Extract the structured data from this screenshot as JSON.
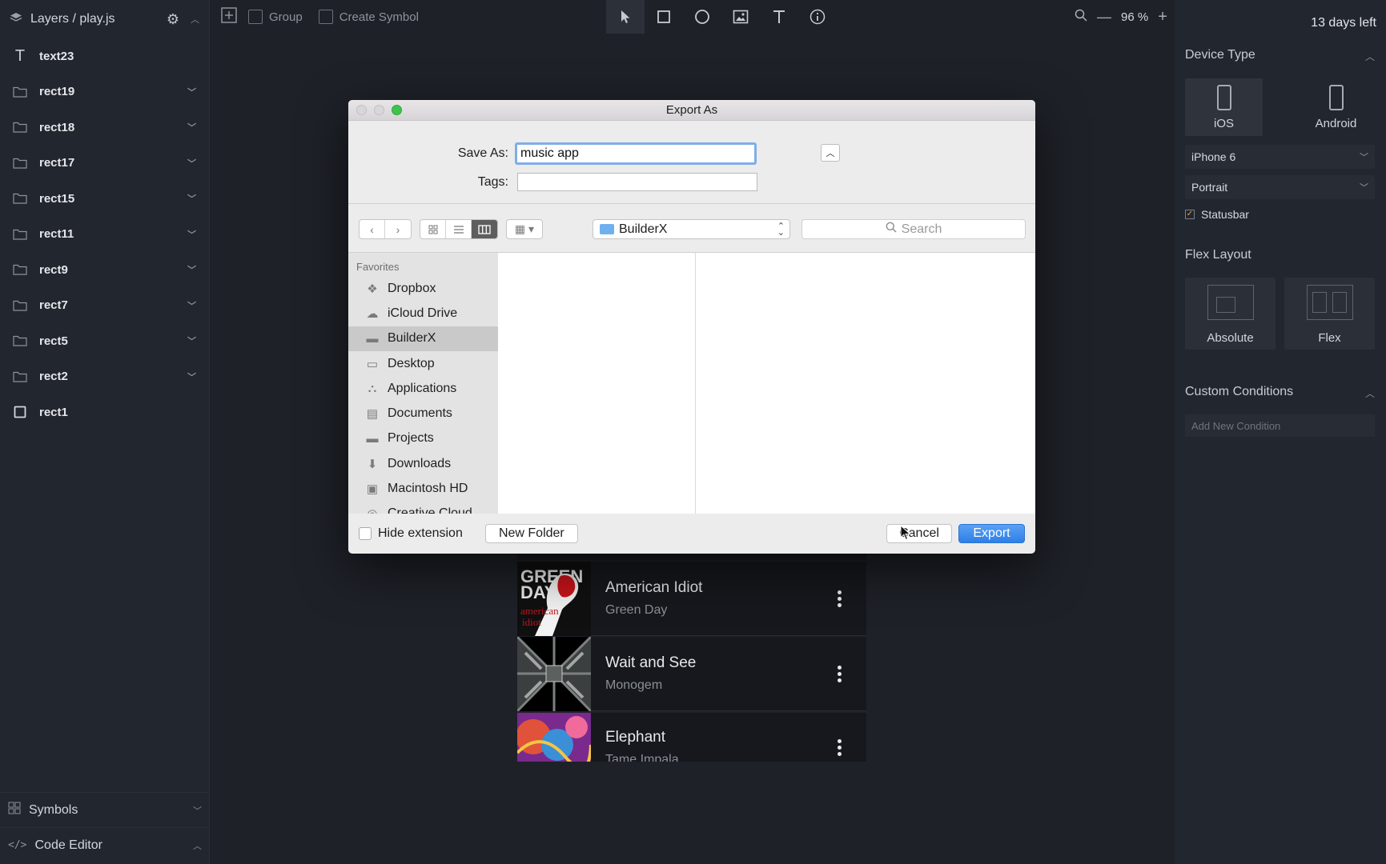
{
  "sidebar": {
    "title": "Layers / play.js",
    "layers": [
      {
        "name": "text23",
        "type": "text",
        "expandable": false
      },
      {
        "name": "rect19",
        "type": "group",
        "expandable": true
      },
      {
        "name": "rect18",
        "type": "group",
        "expandable": true
      },
      {
        "name": "rect17",
        "type": "group",
        "expandable": true
      },
      {
        "name": "rect15",
        "type": "group",
        "expandable": true
      },
      {
        "name": "rect11",
        "type": "group",
        "expandable": true
      },
      {
        "name": "rect9",
        "type": "group",
        "expandable": true
      },
      {
        "name": "rect7",
        "type": "group",
        "expandable": true
      },
      {
        "name": "rect5",
        "type": "group",
        "expandable": true
      },
      {
        "name": "rect2",
        "type": "group",
        "expandable": true
      },
      {
        "name": "rect1",
        "type": "rect",
        "expandable": false
      }
    ],
    "symbols_label": "Symbols",
    "code_editor_label": "Code Editor"
  },
  "toolbar": {
    "group_label": "Group",
    "create_symbol_label": "Create Symbol",
    "tools": [
      "pointer-icon",
      "rectangle-icon",
      "ellipse-icon",
      "image-icon",
      "text-icon",
      "info-icon"
    ],
    "zoom_level": "96 %"
  },
  "right_panel": {
    "trial": "13 days left",
    "device_type_title": "Device Type",
    "devices": [
      "iOS",
      "Android"
    ],
    "selected_device": "iOS",
    "model": "iPhone 6",
    "orientation": "Portrait",
    "statusbar_label": "Statusbar",
    "statusbar_checked": true,
    "flex_layout_title": "Flex Layout",
    "layouts": [
      "Absolute",
      "Flex"
    ],
    "selected_layout": "Absolute",
    "custom_conditions_title": "Custom Conditions",
    "add_condition_placeholder": "Add New Condition"
  },
  "songs": [
    {
      "title": "American Idiot",
      "artist": "Green Day"
    },
    {
      "title": "Wait and See",
      "artist": "Monogem"
    },
    {
      "title": "Elephant",
      "artist": "Tame Impala"
    }
  ],
  "dialog": {
    "title": "Export As",
    "save_as_label": "Save As:",
    "save_as_value": "music app",
    "tags_label": "Tags:",
    "location": "BuilderX",
    "search_placeholder": "Search",
    "favorites_header": "Favorites",
    "favorites": [
      {
        "label": "Dropbox",
        "icon": "dropbox-icon"
      },
      {
        "label": "iCloud Drive",
        "icon": "cloud-icon"
      },
      {
        "label": "BuilderX",
        "icon": "folder-icon"
      },
      {
        "label": "Desktop",
        "icon": "desktop-icon"
      },
      {
        "label": "Applications",
        "icon": "applications-icon"
      },
      {
        "label": "Documents",
        "icon": "documents-icon"
      },
      {
        "label": "Projects",
        "icon": "folder-icon"
      },
      {
        "label": "Downloads",
        "icon": "downloads-icon"
      },
      {
        "label": "Macintosh HD",
        "icon": "disk-icon"
      },
      {
        "label": "Creative Cloud",
        "icon": "creative-cloud-icon"
      }
    ],
    "selected_favorite": "BuilderX",
    "hide_extension_label": "Hide extension",
    "new_folder_label": "New Folder",
    "cancel_label": "Cancel",
    "export_label": "Export"
  },
  "colors": {
    "accent": "#2f7fe6",
    "focus": "#7eaee8",
    "background": "#1e2128",
    "panel": "#22262e"
  }
}
